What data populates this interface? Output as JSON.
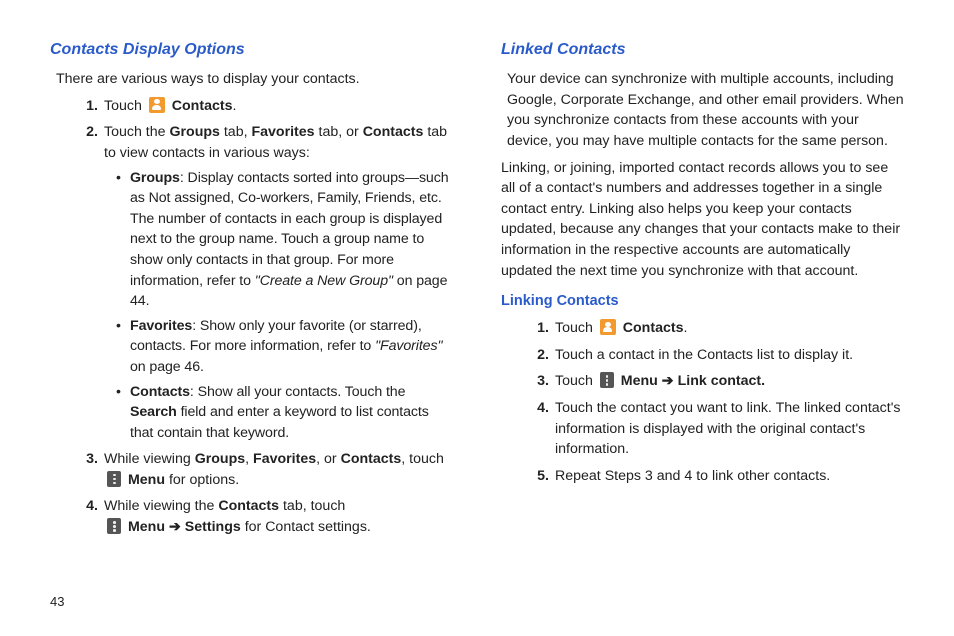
{
  "pageNumber": "43",
  "left": {
    "heading": "Contacts Display Options",
    "intro": "There are various ways to display your contacts.",
    "steps": {
      "s1": {
        "num": "1.",
        "pre": "Touch ",
        "bold": "Contacts",
        "tail": "."
      },
      "s2": {
        "num": "2.",
        "a": "Touch the ",
        "b1": "Groups",
        "c": " tab, ",
        "b2": "Favorites",
        "d": " tab, or ",
        "b3": "Contacts",
        "e": " tab to view contacts in various ways:"
      },
      "bullets": {
        "g1": {
          "bold": "Groups",
          "rest": ": Display contacts sorted into groups—such as Not assigned, Co-workers, Family, Friends, etc. The number of contacts in each group is displayed next to the group name. Touch a group name to show only contacts in that group. For more information, refer to ",
          "ref": "\"Create a New Group\"",
          "tail": " on page 44."
        },
        "g2": {
          "bold": "Favorites",
          "rest": ": Show only your favorite (or starred), contacts. For more information, refer to ",
          "ref": "\"Favorites\"",
          "tail": " on page 46."
        },
        "g3": {
          "bold": "Contacts",
          "rest1": ": Show all your contacts. Touch the ",
          "search": "Search",
          "rest2": " field and enter a keyword to list contacts that contain that keyword."
        }
      },
      "s3": {
        "num": "3.",
        "a": "While viewing ",
        "b1": "Groups",
        "c": ", ",
        "b2": "Favorites",
        "d": ", or ",
        "b3": "Contacts",
        "e": ", touch ",
        "menu": "Menu",
        "f": " for options."
      },
      "s4": {
        "num": "4.",
        "a": "While viewing the ",
        "b1": "Contacts",
        "c": " tab, touch ",
        "menu": "Menu",
        "arrow": " ➔ ",
        "settings": "Settings",
        "tail": " for Contact settings."
      }
    }
  },
  "right": {
    "heading": "Linked Contacts",
    "p1": "Your device can synchronize with multiple accounts, including Google, Corporate Exchange, and other email providers. When you synchronize contacts from these accounts with your device, you may have multiple contacts for the same person.",
    "p2": "Linking, or joining, imported contact records allows you to see all of a contact's numbers and addresses together in a single contact entry. Linking also helps you keep your contacts updated, because any changes that your contacts make to their information in the respective accounts are automatically updated the next time you synchronize with that account.",
    "subhead": "Linking Contacts",
    "steps": {
      "s1": {
        "num": "1.",
        "pre": "Touch ",
        "bold": "Contacts",
        "tail": "."
      },
      "s2": {
        "num": "2.",
        "text": "Touch a contact in the Contacts list to display it."
      },
      "s3": {
        "num": "3.",
        "pre": "Touch ",
        "menu": "Menu",
        "arrow": " ➔ ",
        "link": "Link contact."
      },
      "s4": {
        "num": "4.",
        "text": "Touch the contact you want to link. The linked contact's information is displayed with the original contact's information."
      },
      "s5": {
        "num": "5.",
        "text": "Repeat Steps 3 and 4 to link other contacts."
      }
    }
  }
}
